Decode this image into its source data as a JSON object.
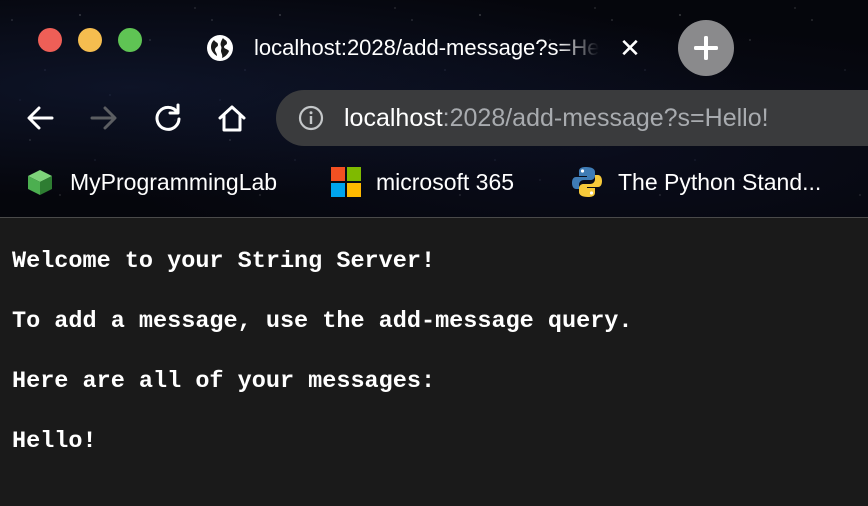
{
  "tab": {
    "title": "localhost:2028/add-message?s=Hello!",
    "close_glyph": "✕",
    "favicon": "globe-icon"
  },
  "new_tab": {
    "icon": "plus-icon"
  },
  "toolbar": {
    "back_icon": "back-arrow-icon",
    "forward_icon": "forward-arrow-icon",
    "reload_icon": "reload-icon",
    "home_icon": "home-icon"
  },
  "omnibox": {
    "info_icon": "info-icon",
    "host": "localhost",
    "rest": ":2028/add-message?s=Hello!"
  },
  "bookmarks": [
    {
      "label": "MyProgrammingLab",
      "icon": "cube-icon"
    },
    {
      "label": "microsoft 365",
      "icon": "microsoft-logo-icon"
    },
    {
      "label": "The Python Stand...",
      "icon": "python-logo-icon"
    }
  ],
  "page": {
    "lines": [
      "Welcome to your String Server!",
      "To add a message, use the add-message query.",
      "Here are all of your messages:",
      "Hello!"
    ]
  },
  "colors": {
    "close": "#ee5f57",
    "minimize": "#f5bd4f",
    "maximize": "#5fc454",
    "page_background": "#1a1a1a",
    "omnibox_background": "#3a3b3d",
    "url_muted": "#a8abaf"
  }
}
